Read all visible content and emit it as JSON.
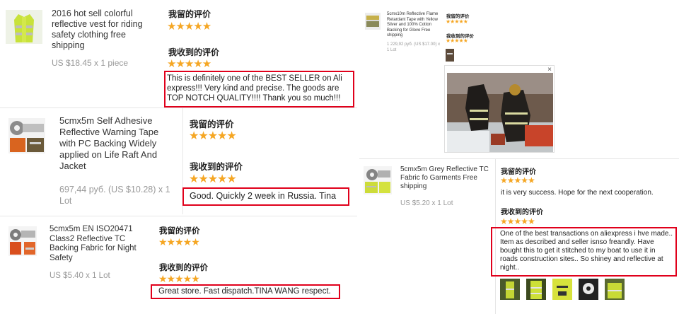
{
  "colors": {
    "accent_red": "#e0001b",
    "star": "#f5a623",
    "price_gray": "#999999"
  },
  "labels": {
    "left_feedback": "我留的评价",
    "received_feedback": "我收到的评价"
  },
  "star_rating": 5,
  "stars_glyph": "★★★★★",
  "cards": [
    {
      "title": "2016 hot sell colorful reflective vest for riding safety clothing free shipping",
      "price": "US $18.45 x 1 piece",
      "review": "This is definitely one of the BEST SELLER on Ali express!!! Very kind and precise. The goods are TOP NOTCH QUALITY!!!! Thank you so much!!!"
    },
    {
      "title": "5cmx5m Self Adhesive Reflective Warning Tape with PC Backing Widely applied on Life Raft And Jacket",
      "price": "697,44 руб. (US $10.28) x 1 Lot",
      "review": "Good. Quickly 2 week in Russia. Tina"
    },
    {
      "title": "5cmx5m EN ISO20471 Class2 Reflective TC Backing Fabric for Night Safety",
      "price": "US $5.40 x 1 Lot",
      "review": "Great store. Fast dispatch.TINA WANG respect."
    },
    {
      "title": "5cmx10m Reflective Flame Retardant Tape with Yellow Silver and 100% Cotton Backing for Glove Free shipping",
      "price": "1 229,92 руб. (US $17.00) x 1 Lot"
    },
    {
      "title": "5cmx5m Grey Reflective TC Fabric fo Garments Free shipping",
      "price": "US $5.20 x 1 Lot",
      "left_review": "it is very success. Hope for the next cooperation.",
      "review": "One of the best transactions on aliexpress i hve made.. Item as described and seller isnso freandly. Have bought this to get it stitched to my boat to use it in roads construction sites.. So shiney and reflective at night.."
    }
  ],
  "photo_close_glyph": "×"
}
